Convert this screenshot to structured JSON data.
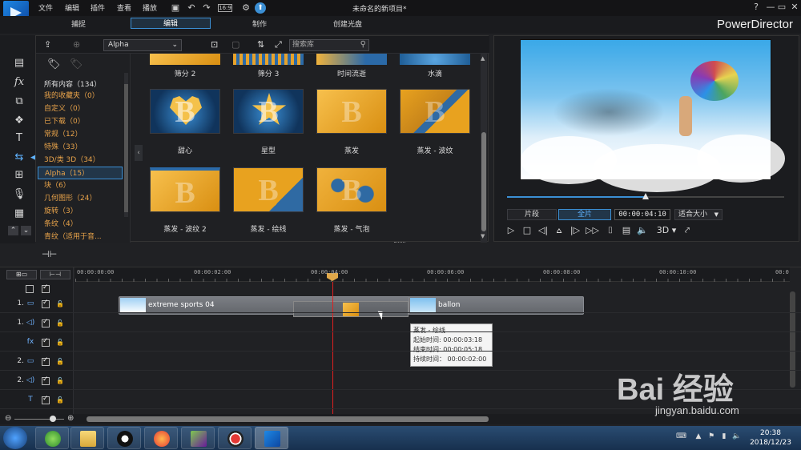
{
  "window": {
    "doc_title": "未命名的新项目*",
    "brand": "PowerDirector",
    "help": "?",
    "minimize": "—",
    "restore": "▭",
    "close": "✕"
  },
  "menu": [
    "文件",
    "编辑",
    "插件",
    "查看",
    "播放"
  ],
  "modes": [
    "捕捉",
    "编辑",
    "制作",
    "创建光盘"
  ],
  "library": {
    "dropdown": "Alpha",
    "search_placeholder": "搜索库",
    "categories": [
      {
        "label": "所有内容（134）"
      },
      {
        "label": "我的收藏夹（0）"
      },
      {
        "label": "自定义（0）"
      },
      {
        "label": "已下载（0）"
      },
      {
        "label": "常规（12）"
      },
      {
        "label": "特殊（33）"
      },
      {
        "label": "3D/类 3D（34）"
      },
      {
        "label": "Alpha（15）"
      },
      {
        "label": "块（6）"
      },
      {
        "label": "几何图形（24）"
      },
      {
        "label": "旋转（3）"
      },
      {
        "label": "条纹（4）"
      },
      {
        "label": "青纹（适用于音..."
      }
    ],
    "top_row": [
      "筛分 2",
      "筛分 3",
      "时间流逝",
      "水滴"
    ],
    "items": [
      {
        "label": "甜心",
        "style": "heart"
      },
      {
        "label": "星型",
        "style": "star"
      },
      {
        "label": "蒸发",
        "style": "gold"
      },
      {
        "label": "蒸发 - 波纹",
        "style": "splash"
      },
      {
        "label": "蒸发 - 波纹 2",
        "style": "gold"
      },
      {
        "label": "蒸发 - 绘线",
        "style": "gold"
      },
      {
        "label": "蒸发 - 气泡",
        "style": "bubble"
      }
    ]
  },
  "preview": {
    "progress_fraction": 0.5,
    "segment_btn": "片段",
    "full_btn": "全片",
    "timecode": "00:00:04:10",
    "fit": "适合大小",
    "threed": "3D"
  },
  "timeline": {
    "ruler": [
      "00:00:00:00",
      "00:00:02:00",
      "00:00:04:00",
      "00:00:06:00",
      "00:00:08:00",
      "00:00:10:00",
      "00:0"
    ],
    "tracks": [
      {
        "num": "1.",
        "icon": "▭"
      },
      {
        "num": "1.",
        "icon": "◁)"
      },
      {
        "num": "",
        "icon": "fx"
      },
      {
        "num": "2.",
        "icon": "▭"
      },
      {
        "num": "2.",
        "icon": "◁)"
      },
      {
        "num": "",
        "icon": "T"
      }
    ],
    "clip1": "extreme sports 04",
    "clip2": "ballon",
    "tooltip": {
      "title": "蒸发 - 绘线",
      "start": "起始时间: 00:00:03:18",
      "end": "结束时间: 00:00:05:18",
      "duration": "持续时间：  00:00:02:00"
    }
  },
  "taskbar": {
    "time": "20:38",
    "date": "2018/12/23"
  },
  "watermark": {
    "main": "Bai 经验",
    "sub": "jingyan.baidu.com"
  }
}
